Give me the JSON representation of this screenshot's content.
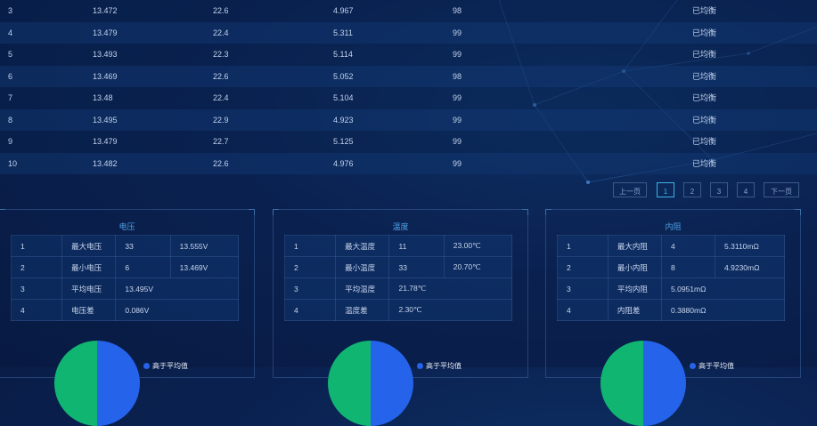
{
  "colors": {
    "pie_above": "#2563eb",
    "pie_below": "#10b572",
    "accent": "#3fb2e6",
    "title": "#4fa3e8"
  },
  "table_rows": [
    [
      "3",
      "13.472",
      "22.6",
      "4.967",
      "98",
      "已均衡"
    ],
    [
      "4",
      "13.479",
      "22.4",
      "5.311",
      "99",
      "已均衡"
    ],
    [
      "5",
      "13.493",
      "22.3",
      "5.114",
      "99",
      "已均衡"
    ],
    [
      "6",
      "13.469",
      "22.6",
      "5.052",
      "98",
      "已均衡"
    ],
    [
      "7",
      "13.48",
      "22.4",
      "5.104",
      "99",
      "已均衡"
    ],
    [
      "8",
      "13.495",
      "22.9",
      "4.923",
      "99",
      "已均衡"
    ],
    [
      "9",
      "13.479",
      "22.7",
      "5.125",
      "99",
      "已均衡"
    ],
    [
      "10",
      "13.482",
      "22.6",
      "4.976",
      "99",
      "已均衡"
    ]
  ],
  "pagination": {
    "prev": "上一页",
    "pages": [
      "1",
      "2",
      "3",
      "4"
    ],
    "current": "1",
    "next": "下一页"
  },
  "panels": [
    {
      "title": "电压",
      "rows": [
        [
          "1",
          "最大电压",
          "33",
          "13.555V"
        ],
        [
          "2",
          "最小电压",
          "6",
          "13.469V"
        ],
        [
          "3",
          "平均电压",
          "13.495V"
        ],
        [
          "4",
          "电压差",
          "0.086V"
        ]
      ],
      "legend": "高于平均值"
    },
    {
      "title": "温度",
      "rows": [
        [
          "1",
          "最大温度",
          "11",
          "23.00℃"
        ],
        [
          "2",
          "最小温度",
          "33",
          "20.70℃"
        ],
        [
          "3",
          "平均温度",
          "21.78℃"
        ],
        [
          "4",
          "温度差",
          "2.30℃"
        ]
      ],
      "legend": "高于平均值"
    },
    {
      "title": "内阻",
      "rows": [
        [
          "1",
          "最大内阻",
          "4",
          "5.3110mΩ"
        ],
        [
          "2",
          "最小内阻",
          "8",
          "4.9230mΩ"
        ],
        [
          "3",
          "平均内阻",
          "5.0951mΩ"
        ],
        [
          "4",
          "内阻差",
          "0.3880mΩ"
        ]
      ],
      "legend": "高于平均值"
    }
  ]
}
